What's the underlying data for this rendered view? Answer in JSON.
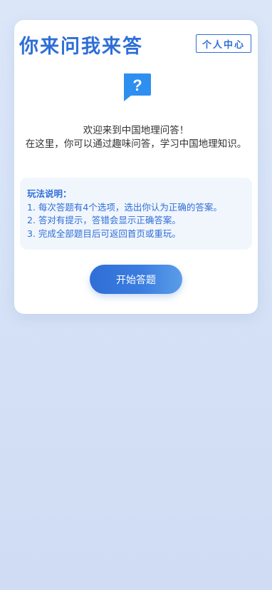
{
  "header": {
    "title": "你来问我来答",
    "profile_button": "个人中心"
  },
  "hero": {
    "icon": "question-bubble-icon",
    "icon_glyph": "?",
    "welcome_line1": "欢迎来到中国地理问答！",
    "welcome_line2": "在这里，你可以通过趣味问答，学习中国地理知识。"
  },
  "rules": {
    "title": "玩法说明：",
    "items": [
      "1. 每次答题有4个选项，选出你认为正确的答案。",
      "2. 答对有提示，答错会显示正确答案。",
      "3. 完成全部题目后可返回首页或重玩。"
    ]
  },
  "start_button": "开始答题",
  "colors": {
    "accent": "#2f6fd6",
    "background": "#d6e2f6",
    "card": "#ffffff",
    "rules_bg": "#f1f6fd",
    "icon": "#2d8ff0"
  }
}
